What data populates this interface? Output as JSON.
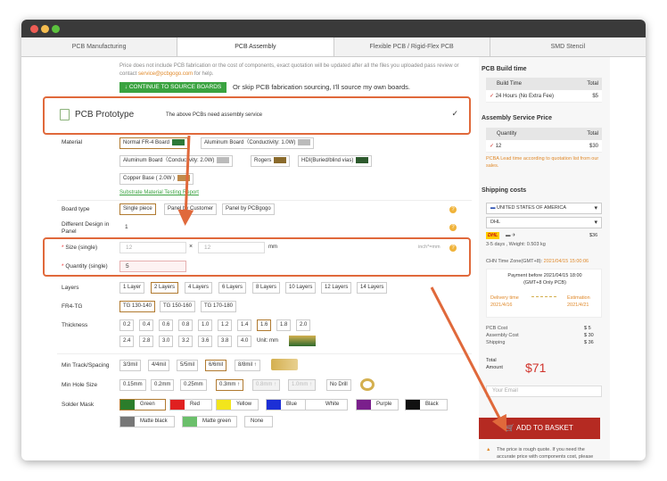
{
  "tabs": [
    "PCB Manufacturing",
    "PCB Assembly",
    "Flexible PCB / Rigid-Flex PCB",
    "SMD Stencil"
  ],
  "note": {
    "text": "Price does not include PCB fabrication or the cost of components, exact quotation will be updated after all the files you uploaded pass review or contact",
    "email": "service@pcbgogo.com",
    "tail": "for help."
  },
  "continue_btn": "↓ CONTINUE TO SOURCE BOARDS",
  "skip_text": "Or skip PCB fabrication sourcing, I'll source my own boards.",
  "prototype": {
    "title": "PCB Prototype",
    "subtitle": "The above PCBs need assembly service",
    "check": "✓"
  },
  "labels": {
    "material": "Material",
    "board_type": "Board type",
    "different_design": "Different Design in Panel",
    "size": "Size (single)",
    "quantity": "Quantity (single)",
    "layers": "Layers",
    "fr4": "FR4-TG",
    "thickness": "Thickness",
    "track": "Min Track/Spacing",
    "hole": "Min Hole Size",
    "mask": "Solder Mask"
  },
  "material": {
    "opts": [
      "Normal FR-4 Board",
      "Aluminum Board（Conductivity: 1.0W)",
      "Aluminum Board（Conductivity: 2.0W)",
      "Rogers",
      "HDI(Buried/blind vias)",
      "Copper Base ( 2.0W )"
    ],
    "link": "Substrate Material Testing Report"
  },
  "board_type": [
    "Single piece",
    "Panel by Customer",
    "Panel by PCBgogo"
  ],
  "different_design": "1",
  "size": {
    "w": "12",
    "h": "12",
    "x": "×",
    "unit": "mm",
    "alt": "inch*=mm"
  },
  "quantity": "5",
  "layers": [
    "1 Layer",
    "2 Layers",
    "4 Layers",
    "6 Layers",
    "8 Layers",
    "10 Layers",
    "12 Layers",
    "14 Layers"
  ],
  "fr4": [
    "TG 130-140",
    "TG 150-160",
    "TG 170-180"
  ],
  "thickness": {
    "row1": [
      "0.2",
      "0.4",
      "0.6",
      "0.8",
      "1.0",
      "1.2",
      "1.4",
      "1.6",
      "1.8",
      "2.0"
    ],
    "row2": [
      "2.4",
      "2.8",
      "3.0",
      "3.2",
      "3.6",
      "3.8",
      "4.0"
    ],
    "unit": "Unit: mm"
  },
  "track": [
    "3/3mil",
    "4/4mil",
    "5/5mil",
    "6/6mil",
    "8/8mil ↑"
  ],
  "hole": [
    "0.15mm",
    "0.2mm",
    "0.25mm",
    "0.3mm ↑",
    "0.8mm ↑",
    "1.0mm ↑",
    "No Drill"
  ],
  "mask": {
    "colors": [
      {
        "name": "Green",
        "color": "#2b7d2b"
      },
      {
        "name": "Red",
        "color": "#e02020"
      },
      {
        "name": "Yellow",
        "color": "#f2e51c"
      },
      {
        "name": "Blue",
        "color": "#1c2fd6"
      },
      {
        "name": "White",
        "color": "#ffffff"
      },
      {
        "name": "Purple",
        "color": "#7a1f8c"
      },
      {
        "name": "Black",
        "color": "#111111"
      }
    ],
    "row2": [
      {
        "name": "Matte black",
        "color": "#777777"
      },
      {
        "name": "Matte green",
        "color": "#6bbf6b"
      },
      {
        "name": "None",
        "color": ""
      }
    ]
  },
  "side": {
    "build_time": "PCB Build time",
    "bt_head": [
      "Build Time",
      "Total"
    ],
    "bt_row": [
      "24 Hours (No Extra Fee)",
      "$5"
    ],
    "assembly": "Assembly Service Price",
    "as_head": [
      "Quantity",
      "Total"
    ],
    "as_row": [
      "12",
      "$30"
    ],
    "as_note": "PCBA Lead time according to quotation list from our sales.",
    "shipping": "Shipping costs",
    "country": "UNITED STATES OF AMERICA",
    "carrier": "DHL",
    "dhl": "DHL",
    "ship_price": "$36",
    "ship_days": "3-5 days ,  Weight: 0.503 kg",
    "tz_label": "CHN Time Zone(GMT+8):",
    "tz_time": "2021/04/15 15:00:06",
    "pay_before": "Payment before 2021/04/15 18:00 (GMT+8 Only PCB)",
    "delivery_label": "Delivery time",
    "delivery_date": "2021/4/16",
    "estimation_label": "Estimation",
    "estimation_date": "2021/4/21",
    "costs": [
      [
        "PCB Cost",
        "$ 5"
      ],
      [
        "Assembly Cost",
        "$ 30"
      ],
      [
        "Shipping",
        "$ 36"
      ]
    ],
    "total_label": "Total Amount",
    "total": "$71",
    "email_ph": "Your Email",
    "basket": "ADD TO BASKET",
    "warn": "The price is rough quote. If you need the accurate price with components cost, please register and upload the files."
  }
}
